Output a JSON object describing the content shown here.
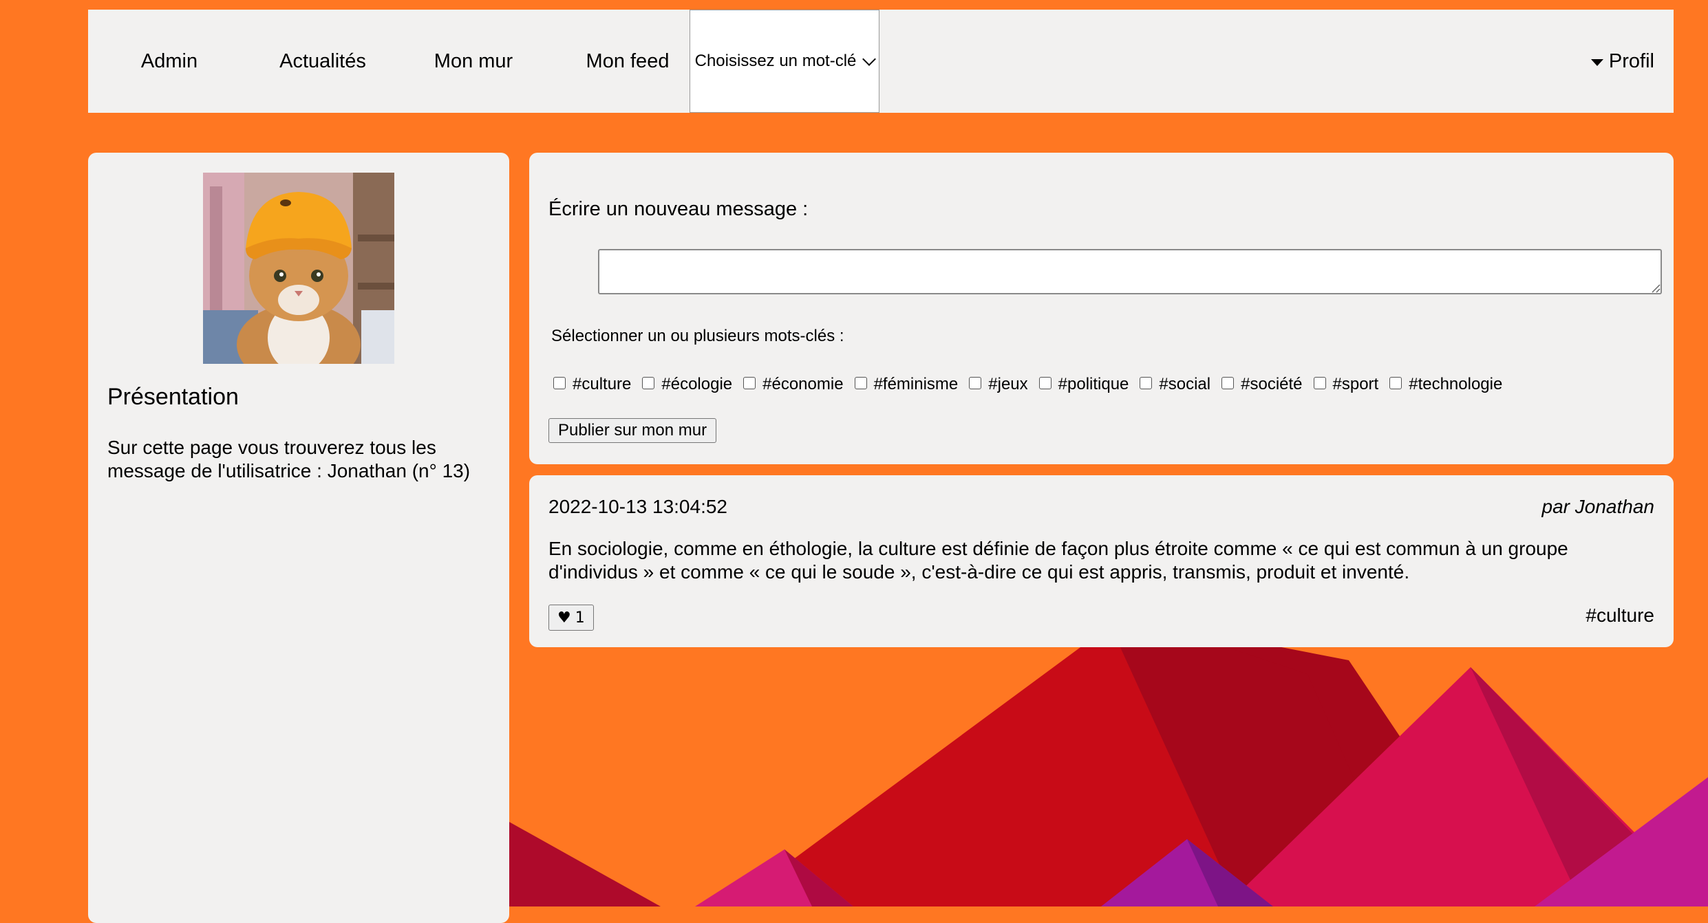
{
  "nav": {
    "items": [
      {
        "label": "Admin"
      },
      {
        "label": "Actualités"
      },
      {
        "label": "Mon mur"
      },
      {
        "label": "Mon feed"
      }
    ],
    "keyword_select": {
      "selected": "Choisissez un mot-clé"
    },
    "profile_label": "Profil"
  },
  "sidebar": {
    "presentation_title": "Présentation",
    "presentation_text": "Sur cette page vous trouverez tous les message de l'utilisatrice : Jonathan (n° 13)"
  },
  "compose": {
    "title": "Écrire un nouveau message :",
    "message_value": "",
    "tags_label": "Sélectionner un ou plusieurs mots-clés :",
    "tags": [
      {
        "label": "#culture",
        "checked": false
      },
      {
        "label": "#écologie",
        "checked": false
      },
      {
        "label": "#économie",
        "checked": false
      },
      {
        "label": "#féminisme",
        "checked": false
      },
      {
        "label": "#jeux",
        "checked": false
      },
      {
        "label": "#politique",
        "checked": false
      },
      {
        "label": "#social",
        "checked": false
      },
      {
        "label": "#société",
        "checked": false
      },
      {
        "label": "#sport",
        "checked": false
      },
      {
        "label": "#technologie",
        "checked": false
      }
    ],
    "publish_label": "Publier sur mon mur"
  },
  "posts": [
    {
      "date": "2022-10-13 13:04:52",
      "author": "par Jonathan",
      "body": "En sociologie, comme en éthologie, la culture est définie de façon plus étroite comme « ce qui est commun à un groupe d'individus » et comme « ce qui le soude », c'est-à-dire ce qui est appris, transmis, produit et inventé.",
      "likes": "1",
      "like_icon": "heart-icon",
      "tag": "#culture"
    }
  ],
  "colors": {
    "background": "#ff7722",
    "panel": "#f2f1f0",
    "mountain_red": "#c80b17",
    "mountain_dark_red": "#a6071b",
    "mountain_pink": "#d7104e",
    "mountain_magenta": "#c21a8f",
    "mountain_purple": "#a4199c"
  }
}
